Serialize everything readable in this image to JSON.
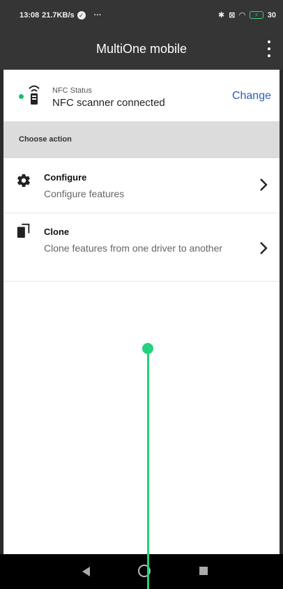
{
  "status_bar": {
    "time": "13:08",
    "speed": "21.7KB/s",
    "more": "···",
    "battery": "30"
  },
  "app_bar": {
    "title": "MultiOne mobile",
    "menu_icon": "more-vert-icon"
  },
  "nfc": {
    "label": "NFC Status",
    "value": "NFC scanner connected",
    "action": "Change",
    "indicator_color": "#1fbf6b"
  },
  "section": {
    "title": "Choose action"
  },
  "actions": [
    {
      "title": "Configure",
      "subtitle": "Configure features",
      "icon": "gear-icon"
    },
    {
      "title": "Clone",
      "subtitle": "Clone features from one driver to another",
      "icon": "clone-icon"
    }
  ],
  "colors": {
    "app_bar": "#353535",
    "link": "#2a5fb8",
    "touch_indicator": "#22d27c"
  }
}
